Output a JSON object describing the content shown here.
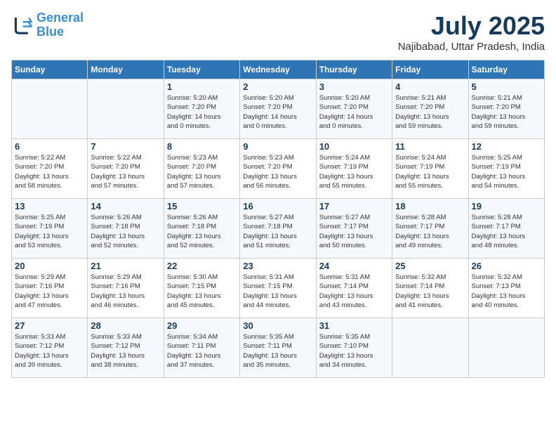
{
  "logo": {
    "line1": "General",
    "line2": "Blue"
  },
  "title": "July 2025",
  "location": "Najibabad, Uttar Pradesh, India",
  "headers": [
    "Sunday",
    "Monday",
    "Tuesday",
    "Wednesday",
    "Thursday",
    "Friday",
    "Saturday"
  ],
  "weeks": [
    [
      {
        "day": "",
        "info": ""
      },
      {
        "day": "",
        "info": ""
      },
      {
        "day": "1",
        "info": "Sunrise: 5:20 AM\nSunset: 7:20 PM\nDaylight: 14 hours\nand 0 minutes."
      },
      {
        "day": "2",
        "info": "Sunrise: 5:20 AM\nSunset: 7:20 PM\nDaylight: 14 hours\nand 0 minutes."
      },
      {
        "day": "3",
        "info": "Sunrise: 5:20 AM\nSunset: 7:20 PM\nDaylight: 14 hours\nand 0 minutes."
      },
      {
        "day": "4",
        "info": "Sunrise: 5:21 AM\nSunset: 7:20 PM\nDaylight: 13 hours\nand 59 minutes."
      },
      {
        "day": "5",
        "info": "Sunrise: 5:21 AM\nSunset: 7:20 PM\nDaylight: 13 hours\nand 59 minutes."
      }
    ],
    [
      {
        "day": "6",
        "info": "Sunrise: 5:22 AM\nSunset: 7:20 PM\nDaylight: 13 hours\nand 58 minutes."
      },
      {
        "day": "7",
        "info": "Sunrise: 5:22 AM\nSunset: 7:20 PM\nDaylight: 13 hours\nand 57 minutes."
      },
      {
        "day": "8",
        "info": "Sunrise: 5:23 AM\nSunset: 7:20 PM\nDaylight: 13 hours\nand 57 minutes."
      },
      {
        "day": "9",
        "info": "Sunrise: 5:23 AM\nSunset: 7:20 PM\nDaylight: 13 hours\nand 56 minutes."
      },
      {
        "day": "10",
        "info": "Sunrise: 5:24 AM\nSunset: 7:19 PM\nDaylight: 13 hours\nand 55 minutes."
      },
      {
        "day": "11",
        "info": "Sunrise: 5:24 AM\nSunset: 7:19 PM\nDaylight: 13 hours\nand 55 minutes."
      },
      {
        "day": "12",
        "info": "Sunrise: 5:25 AM\nSunset: 7:19 PM\nDaylight: 13 hours\nand 54 minutes."
      }
    ],
    [
      {
        "day": "13",
        "info": "Sunrise: 5:25 AM\nSunset: 7:19 PM\nDaylight: 13 hours\nand 53 minutes."
      },
      {
        "day": "14",
        "info": "Sunrise: 5:26 AM\nSunset: 7:18 PM\nDaylight: 13 hours\nand 52 minutes."
      },
      {
        "day": "15",
        "info": "Sunrise: 5:26 AM\nSunset: 7:18 PM\nDaylight: 13 hours\nand 52 minutes."
      },
      {
        "day": "16",
        "info": "Sunrise: 5:27 AM\nSunset: 7:18 PM\nDaylight: 13 hours\nand 51 minutes."
      },
      {
        "day": "17",
        "info": "Sunrise: 5:27 AM\nSunset: 7:17 PM\nDaylight: 13 hours\nand 50 minutes."
      },
      {
        "day": "18",
        "info": "Sunrise: 5:28 AM\nSunset: 7:17 PM\nDaylight: 13 hours\nand 49 minutes."
      },
      {
        "day": "19",
        "info": "Sunrise: 5:28 AM\nSunset: 7:17 PM\nDaylight: 13 hours\nand 48 minutes."
      }
    ],
    [
      {
        "day": "20",
        "info": "Sunrise: 5:29 AM\nSunset: 7:16 PM\nDaylight: 13 hours\nand 47 minutes."
      },
      {
        "day": "21",
        "info": "Sunrise: 5:29 AM\nSunset: 7:16 PM\nDaylight: 13 hours\nand 46 minutes."
      },
      {
        "day": "22",
        "info": "Sunrise: 5:30 AM\nSunset: 7:15 PM\nDaylight: 13 hours\nand 45 minutes."
      },
      {
        "day": "23",
        "info": "Sunrise: 5:31 AM\nSunset: 7:15 PM\nDaylight: 13 hours\nand 44 minutes."
      },
      {
        "day": "24",
        "info": "Sunrise: 5:31 AM\nSunset: 7:14 PM\nDaylight: 13 hours\nand 43 minutes."
      },
      {
        "day": "25",
        "info": "Sunrise: 5:32 AM\nSunset: 7:14 PM\nDaylight: 13 hours\nand 41 minutes."
      },
      {
        "day": "26",
        "info": "Sunrise: 5:32 AM\nSunset: 7:13 PM\nDaylight: 13 hours\nand 40 minutes."
      }
    ],
    [
      {
        "day": "27",
        "info": "Sunrise: 5:33 AM\nSunset: 7:12 PM\nDaylight: 13 hours\nand 39 minutes."
      },
      {
        "day": "28",
        "info": "Sunrise: 5:33 AM\nSunset: 7:12 PM\nDaylight: 13 hours\nand 38 minutes."
      },
      {
        "day": "29",
        "info": "Sunrise: 5:34 AM\nSunset: 7:11 PM\nDaylight: 13 hours\nand 37 minutes."
      },
      {
        "day": "30",
        "info": "Sunrise: 5:35 AM\nSunset: 7:11 PM\nDaylight: 13 hours\nand 35 minutes."
      },
      {
        "day": "31",
        "info": "Sunrise: 5:35 AM\nSunset: 7:10 PM\nDaylight: 13 hours\nand 34 minutes."
      },
      {
        "day": "",
        "info": ""
      },
      {
        "day": "",
        "info": ""
      }
    ]
  ]
}
